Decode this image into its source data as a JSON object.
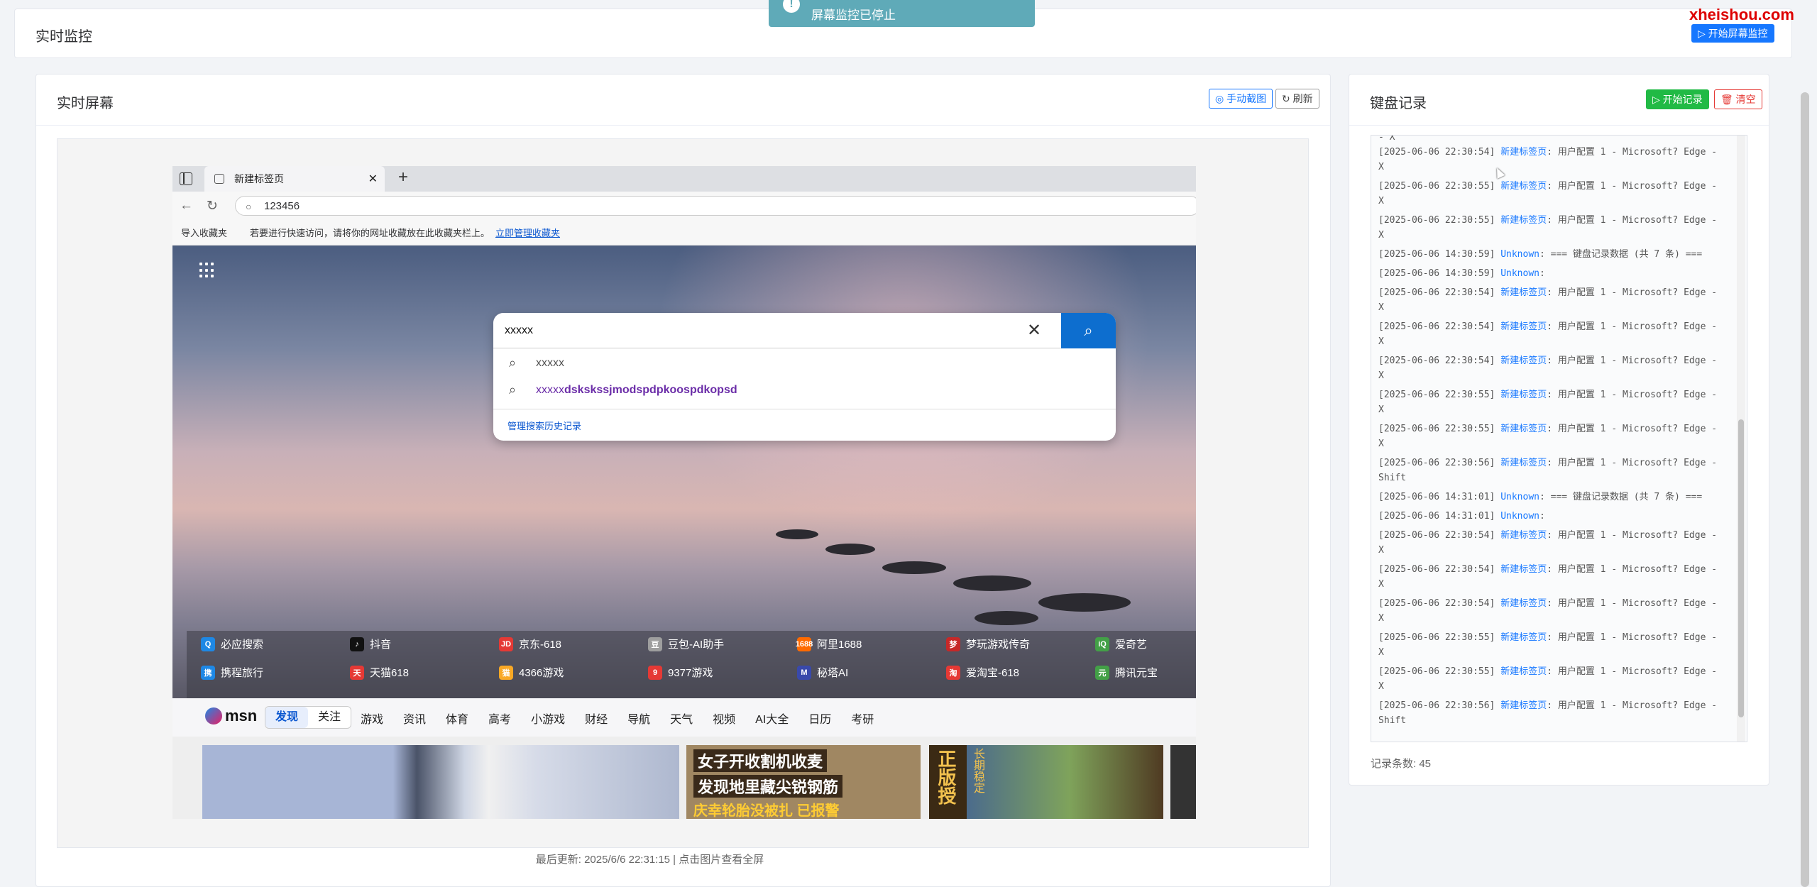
{
  "page": {
    "title": "实时监控",
    "start_screen_button": "▷ 开始屏幕监控",
    "watermark": "xheishou.com"
  },
  "toast": {
    "icon": "!",
    "text": "屏幕监控已停止"
  },
  "screen_panel": {
    "title": "实时屏幕",
    "manual_capture_button": "◎ 手动截图",
    "refresh_button": "↻ 刷新",
    "last_update": "最后更新: 2025/6/6 22:31:15 | 点击图片查看全屏"
  },
  "screenshot": {
    "tab_title": "新建标签页",
    "tab_close": "✕",
    "new_tab": "+",
    "address": "123456",
    "fav_import": "导入收藏夹",
    "fav_hint": "若要进行快速访问，请将你的网址收藏放在此收藏夹栏上。",
    "fav_link": "立即管理收藏夹",
    "search_value": "xxxxx",
    "suggestions": [
      {
        "prefix": "xxxxx",
        "bold": ""
      },
      {
        "prefix": "xxxxx",
        "bold": "dskskssjmodspdpkoospdkopsd"
      }
    ],
    "manage_history": "管理搜索历史记录",
    "quick_links": [
      {
        "label": "必应搜索",
        "color": "#1e88e5",
        "glyph": "Q"
      },
      {
        "label": "抖音",
        "color": "#111111",
        "glyph": "♪"
      },
      {
        "label": "京东-618",
        "color": "#e53935",
        "glyph": "JD"
      },
      {
        "label": "豆包-AI助手",
        "color": "#9e9e9e",
        "glyph": "豆"
      },
      {
        "label": "阿里1688",
        "color": "#ff6a00",
        "glyph": "1688"
      },
      {
        "label": "梦玩游戏传奇",
        "color": "#c62828",
        "glyph": "梦"
      },
      {
        "label": "爱奇艺",
        "color": "#43a047",
        "glyph": "iQ"
      },
      {
        "label": "携程旅行",
        "color": "#1e88e5",
        "glyph": "携"
      },
      {
        "label": "天猫618",
        "color": "#e53935",
        "glyph": "天"
      },
      {
        "label": "4366游戏",
        "color": "#f9a825",
        "glyph": "猫"
      },
      {
        "label": "9377游戏",
        "color": "#e53935",
        "glyph": "9"
      },
      {
        "label": "秘塔AI",
        "color": "#3949ab",
        "glyph": "M"
      },
      {
        "label": "爱淘宝-618",
        "color": "#e53935",
        "glyph": "淘"
      },
      {
        "label": "腾讯元宝",
        "color": "#43a047",
        "glyph": "元"
      }
    ],
    "msn_logo": "msn",
    "msn_tabs": [
      "发现",
      "关注"
    ],
    "msn_nav": [
      "游戏",
      "资讯",
      "体育",
      "高考",
      "小游戏",
      "财经",
      "导航",
      "天气",
      "视频",
      "AI大全",
      "日历",
      "考研"
    ],
    "tile_texts": [
      "女子开收割机收麦",
      "发现地里藏尖锐钢筋",
      "庆幸轮胎没被扎 已报警",
      "正版授",
      "长期稳定"
    ]
  },
  "keyboard_panel": {
    "title": "键盘记录",
    "start_button": "▷ 开始记录",
    "clear_button": "🗑 清空",
    "count_label": "记录条数: 45",
    "log_top_fragment": "- X",
    "logs": [
      {
        "time": "[2025-06-06 22:30:54]",
        "src": "新建标签页",
        "text": ": 用户配置 1 - Microsoft? Edge - X"
      },
      {
        "time": "[2025-06-06 22:30:55]",
        "src": "新建标签页",
        "text": ": 用户配置 1 - Microsoft? Edge - X"
      },
      {
        "time": "[2025-06-06 22:30:55]",
        "src": "新建标签页",
        "text": ": 用户配置 1 - Microsoft? Edge - X"
      },
      {
        "time": "[2025-06-06 14:30:59]",
        "src": "Unknown",
        "text": ": === 键盘记录数据 (共 7 条) ==="
      },
      {
        "time": "[2025-06-06 14:30:59]",
        "src": "Unknown",
        "text": ":"
      },
      {
        "time": "[2025-06-06 22:30:54]",
        "src": "新建标签页",
        "text": ": 用户配置 1 - Microsoft? Edge - X"
      },
      {
        "time": "[2025-06-06 22:30:54]",
        "src": "新建标签页",
        "text": ": 用户配置 1 - Microsoft? Edge - X"
      },
      {
        "time": "[2025-06-06 22:30:54]",
        "src": "新建标签页",
        "text": ": 用户配置 1 - Microsoft? Edge - X"
      },
      {
        "time": "[2025-06-06 22:30:55]",
        "src": "新建标签页",
        "text": ": 用户配置 1 - Microsoft? Edge - X"
      },
      {
        "time": "[2025-06-06 22:30:55]",
        "src": "新建标签页",
        "text": ": 用户配置 1 - Microsoft? Edge - X"
      },
      {
        "time": "[2025-06-06 22:30:56]",
        "src": "新建标签页",
        "text": ": 用户配置 1 - Microsoft? Edge - Shift"
      },
      {
        "time": "[2025-06-06 14:31:01]",
        "src": "Unknown",
        "text": ": === 键盘记录数据 (共 7 条) ==="
      },
      {
        "time": "[2025-06-06 14:31:01]",
        "src": "Unknown",
        "text": ":"
      },
      {
        "time": "[2025-06-06 22:30:54]",
        "src": "新建标签页",
        "text": ": 用户配置 1 - Microsoft? Edge - X"
      },
      {
        "time": "[2025-06-06 22:30:54]",
        "src": "新建标签页",
        "text": ": 用户配置 1 - Microsoft? Edge - X"
      },
      {
        "time": "[2025-06-06 22:30:54]",
        "src": "新建标签页",
        "text": ": 用户配置 1 - Microsoft? Edge - X"
      },
      {
        "time": "[2025-06-06 22:30:55]",
        "src": "新建标签页",
        "text": ": 用户配置 1 - Microsoft? Edge - X"
      },
      {
        "time": "[2025-06-06 22:30:55]",
        "src": "新建标签页",
        "text": ": 用户配置 1 - Microsoft? Edge - X"
      },
      {
        "time": "[2025-06-06 22:30:56]",
        "src": "新建标签页",
        "text": ": 用户配置 1 - Microsoft? Edge - Shift"
      }
    ]
  },
  "colors": {
    "primary": "#1677ff",
    "success": "#21ba45",
    "danger": "#e53935",
    "toast": "#5faab8"
  }
}
